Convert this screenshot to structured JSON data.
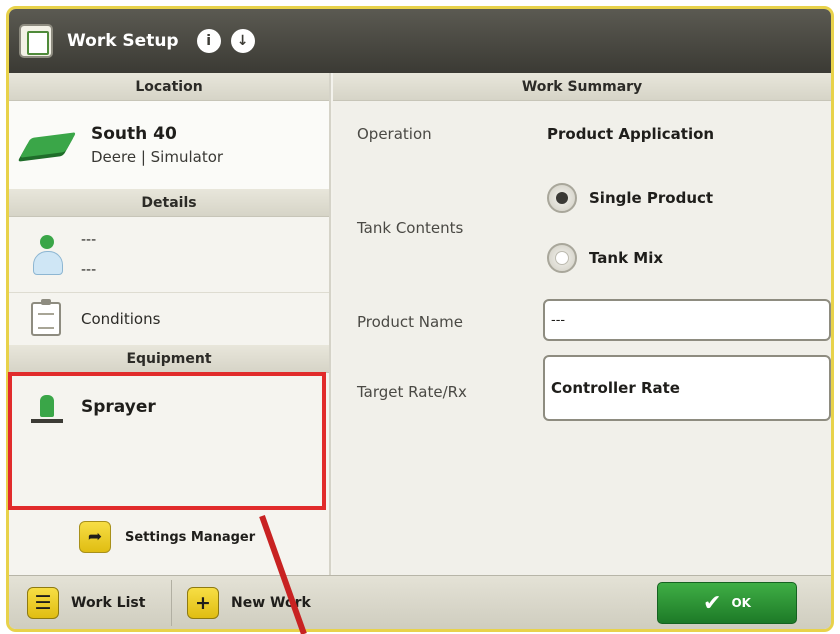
{
  "window": {
    "title": "Work Setup",
    "info_icon": "info-icon",
    "download_icon": "download-icon"
  },
  "left_panel": {
    "location_header": "Location",
    "location": {
      "name": "South 40",
      "sub": "Deere | Simulator"
    },
    "details_header": "Details",
    "details": {
      "line1": "---",
      "line2": "---"
    },
    "conditions_label": "Conditions",
    "equipment_header": "Equipment",
    "equipment_name": "Sprayer",
    "settings_manager_label": "Settings Manager"
  },
  "work_summary": {
    "header": "Work Summary",
    "operation_label": "Operation",
    "operation_value": "Product Application",
    "tank_contents_label": "Tank Contents",
    "tank_options": [
      {
        "label": "Single Product",
        "selected": true
      },
      {
        "label": "Tank Mix",
        "selected": false
      }
    ],
    "product_name_label": "Product Name",
    "product_name_value": "---",
    "target_rate_label": "Target Rate/Rx",
    "target_rate_value": "Controller Rate"
  },
  "bottom_bar": {
    "work_list_label": "Work List",
    "new_work_label": "New Work",
    "ok_label": "OK"
  },
  "colors": {
    "title_bar": "#3b3a34",
    "accent_green": "#2e9a38",
    "accent_yellow": "#e9c81e",
    "highlight_red": "#e12b2b"
  }
}
